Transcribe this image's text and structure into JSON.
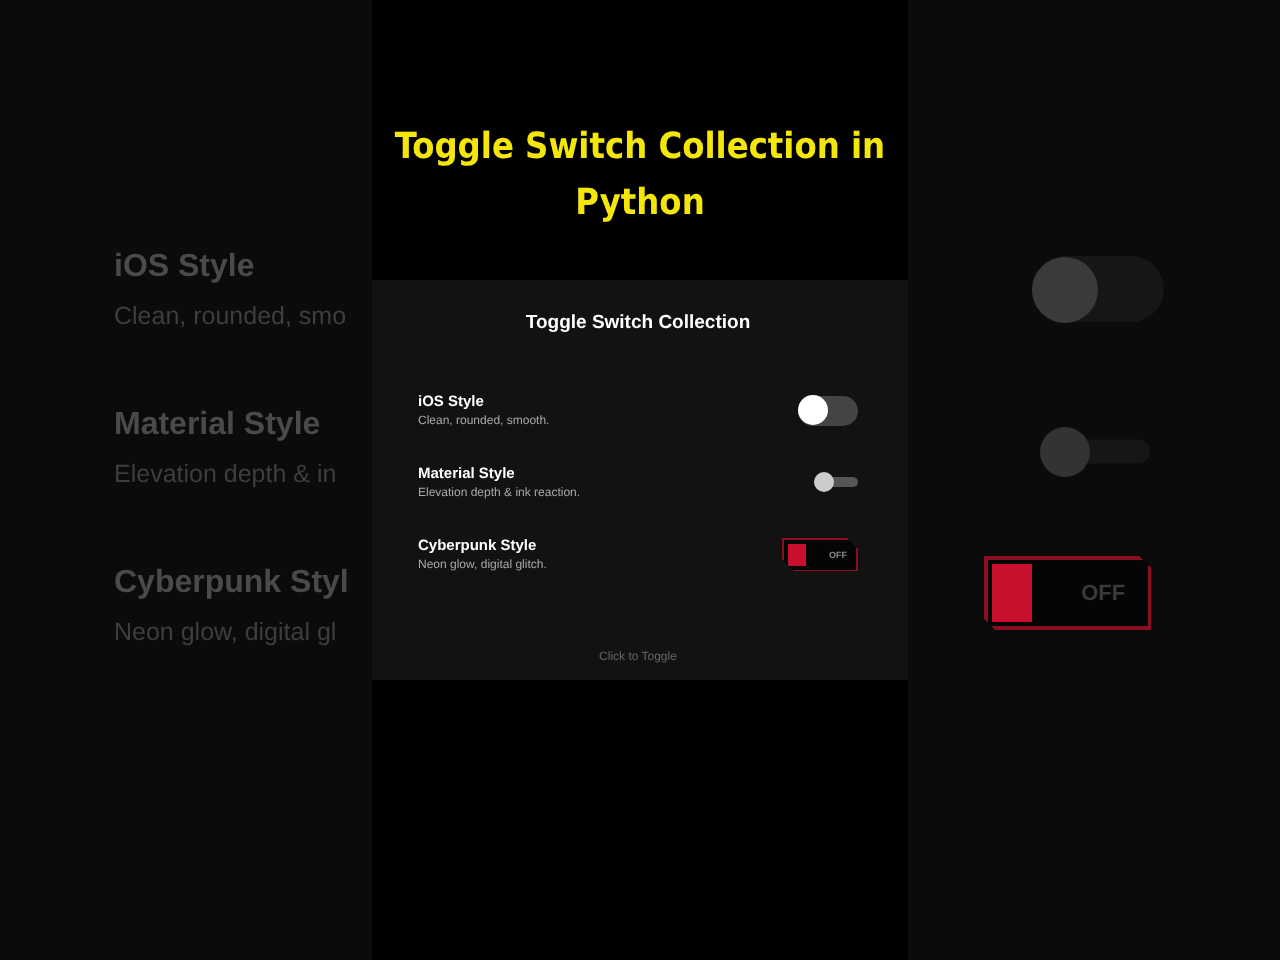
{
  "video_title": "Toggle Switch Collection in Python",
  "backdrop": {
    "items": [
      {
        "label": "iOS Style",
        "description": "Clean, rounded, smo"
      },
      {
        "label": "Material Style",
        "description": "Elevation depth & in"
      },
      {
        "label": "Cyberpunk Styl",
        "description": "Neon glow, digital gl"
      }
    ],
    "toggles": [
      {
        "kind": "ios",
        "on": false
      },
      {
        "kind": "material",
        "on": false
      },
      {
        "kind": "cyberpunk",
        "on": false,
        "caption": "OFF"
      }
    ]
  },
  "window": {
    "title": "Toggle Switch Collection",
    "rows": [
      {
        "label": "iOS Style",
        "description": "Clean, rounded, smooth.",
        "kind": "ios",
        "on": false
      },
      {
        "label": "Material Style",
        "description": "Elevation depth & ink reaction.",
        "kind": "material",
        "on": false
      },
      {
        "label": "Cyberpunk Style",
        "description": "Neon glow, digital glitch.",
        "kind": "cyberpunk",
        "on": false,
        "caption": "OFF"
      }
    ],
    "hint": "Click to Toggle"
  }
}
